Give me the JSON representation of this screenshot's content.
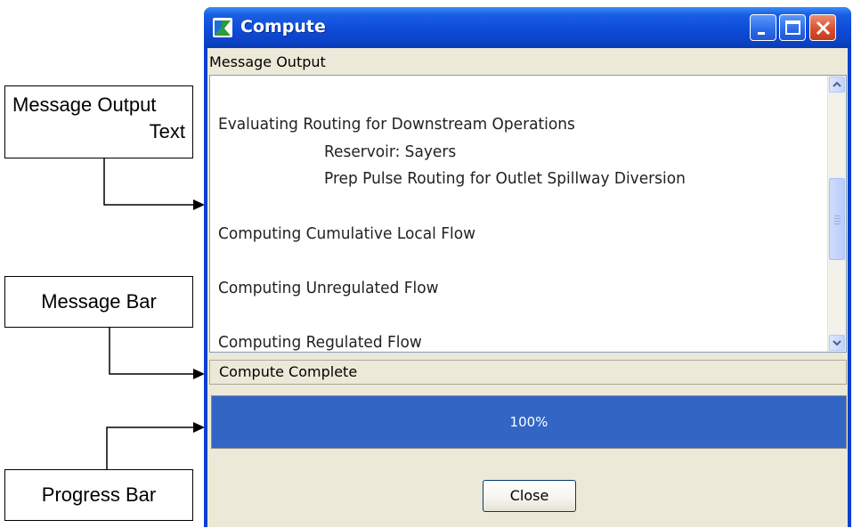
{
  "callouts": {
    "message_output_text_line1": "Message Output",
    "message_output_text_line2": "Text",
    "message_bar": "Message Bar",
    "progress_bar": "Progress Bar"
  },
  "window": {
    "title": "Compute",
    "icon": "compute-app-icon",
    "controls": [
      "minimize-icon",
      "maximize-icon",
      "close-icon"
    ],
    "titlebar_color": "#0b4ad8",
    "close_color": "#d9502f"
  },
  "message_output": {
    "label": "Message Output",
    "lines": [
      "Evaluating Routing for Downstream Operations",
      "Reservoir: Sayers",
      "Prep Pulse Routing for Outlet Spillway Diversion",
      "Computing Cumulative Local Flow",
      "Computing Unregulated Flow",
      "Computing Regulated Flow"
    ]
  },
  "message_bar": {
    "text": "Compute Complete"
  },
  "progress": {
    "text": "100%",
    "value": 1.0,
    "color": "#3365c4"
  },
  "buttons": {
    "close": "Close"
  }
}
